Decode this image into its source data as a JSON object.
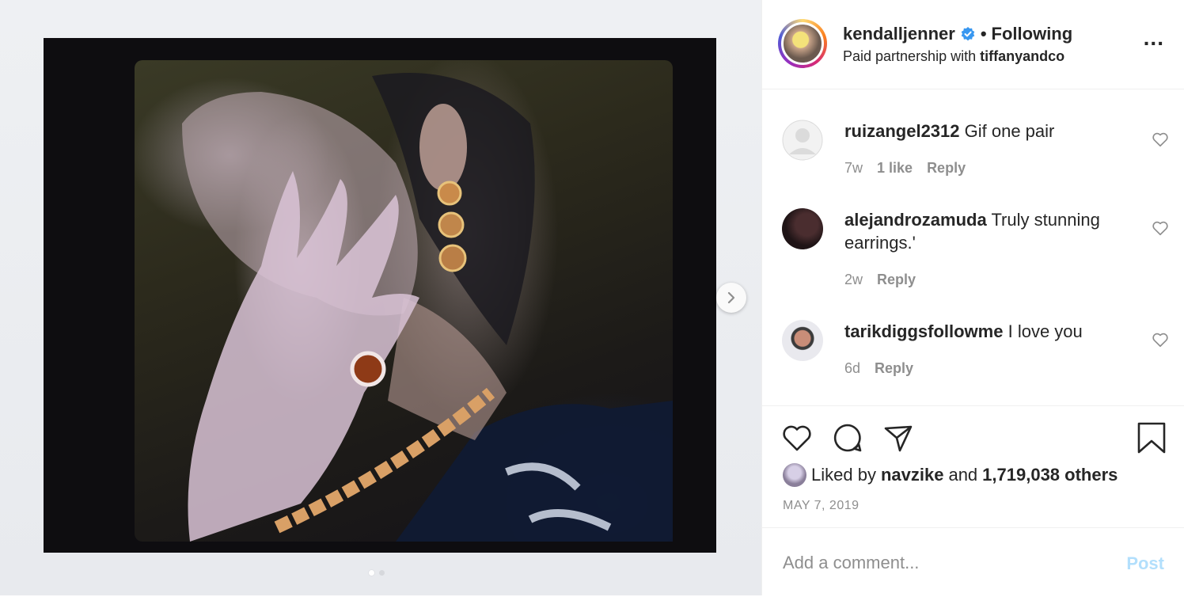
{
  "header": {
    "username": "kendalljenner",
    "separator": "•",
    "following_label": "Following",
    "partnership_prefix": "Paid partnership with",
    "partner": "tiffanyandco",
    "more_label": "..."
  },
  "comments": [
    {
      "user": "ruizangel2312",
      "text": "Gif one pair",
      "time": "7w",
      "likes": "1 like",
      "reply": "Reply"
    },
    {
      "user": "alejandrozamuda",
      "text": "Truly stunning earrings.'",
      "time": "2w",
      "likes": "",
      "reply": "Reply"
    },
    {
      "user": "tarikdiggsfollowme",
      "text": "I love you",
      "time": "6d",
      "likes": "",
      "reply": "Reply"
    }
  ],
  "likes": {
    "prefix": "Liked by",
    "user": "navzike",
    "conjunction": "and",
    "count": "1,719,038 others"
  },
  "date": "MAY 7, 2019",
  "comment_box": {
    "placeholder": "Add a comment...",
    "post_label": "Post"
  },
  "carousel": {
    "total": 2,
    "current": 1
  },
  "colors": {
    "link": "#b2dffc",
    "meta": "#8e8e8e",
    "text": "#262626",
    "verified": "#3897f0"
  },
  "icons": [
    "verified-badge-icon",
    "more-options-icon",
    "heart-icon",
    "comment-icon",
    "share-icon",
    "bookmark-icon",
    "chevron-right-icon"
  ]
}
